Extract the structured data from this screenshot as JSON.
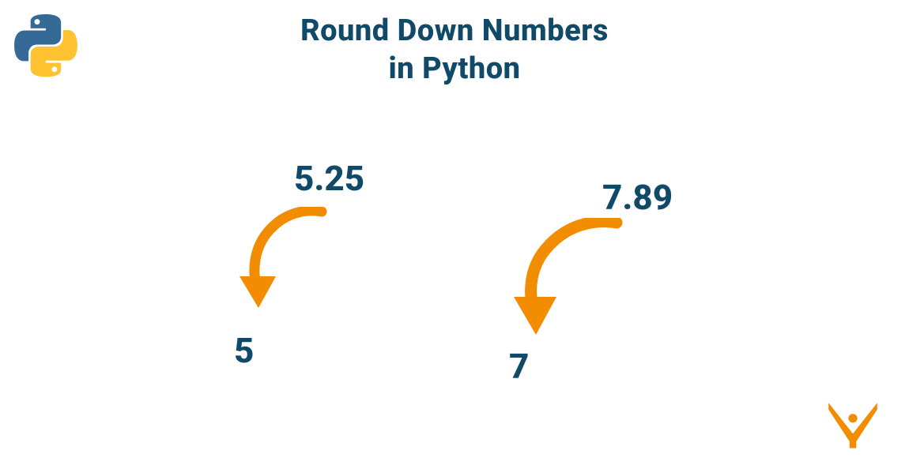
{
  "title": {
    "line1": "Round Down Numbers",
    "line2": "in Python"
  },
  "examples": [
    {
      "input": "5.25",
      "output": "5"
    },
    {
      "input": "7.89",
      "output": "7"
    }
  ],
  "colors": {
    "text": "#104a68",
    "accent": "#F28C00",
    "python_blue": "#366A96",
    "python_yellow": "#FFC331"
  },
  "icons": {
    "python": "python-logo-icon",
    "brand": "brand-logo-icon",
    "arrow": "curved-down-arrow-icon"
  }
}
